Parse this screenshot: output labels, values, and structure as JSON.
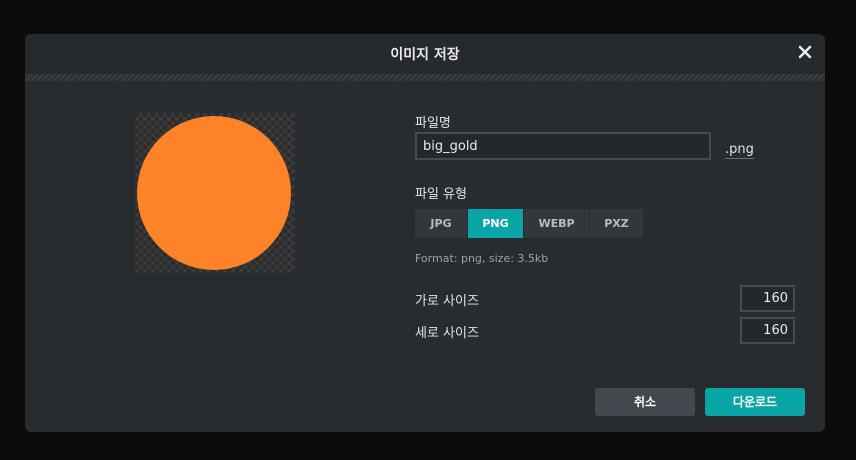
{
  "dialog": {
    "title": "이미지 저장",
    "close_icon": "close-icon"
  },
  "preview": {
    "shape": "circle",
    "fill_color": "#fe8228",
    "background": "transparent-checkerboard"
  },
  "filename": {
    "label": "파일명",
    "value": "big_gold",
    "extension": ".png"
  },
  "file_type": {
    "label": "파일 유형",
    "options": [
      "JPG",
      "PNG",
      "WEBP",
      "PXZ"
    ],
    "selected": "PNG"
  },
  "format_info": "Format: png, size: 3.5kb",
  "width": {
    "label": "가로 사이즈",
    "value": "160"
  },
  "height": {
    "label": "세로 사이즈",
    "value": "160"
  },
  "buttons": {
    "cancel": "취소",
    "download": "다운로드"
  },
  "colors": {
    "accent": "#0aa5a6",
    "dialog_bg": "#282b2f",
    "preview_orange": "#fe8228"
  }
}
